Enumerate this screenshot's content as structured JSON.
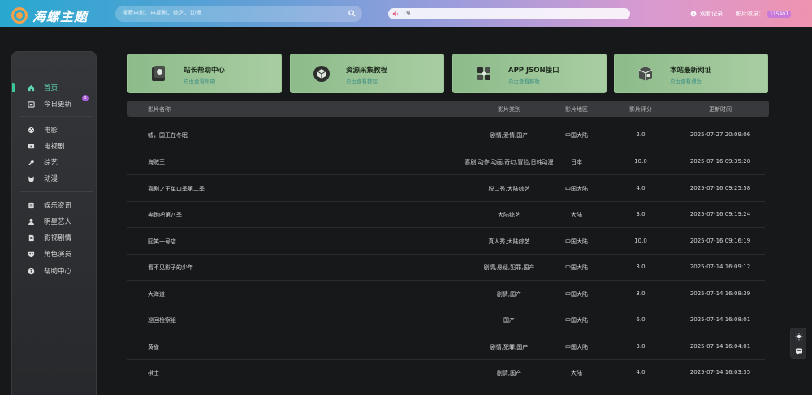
{
  "header": {
    "logo_text": "海螺主题",
    "search_placeholder": "搜索电影、电视剧、综艺、动漫",
    "notice_text": "19",
    "history_label": "观看记录",
    "stats_label": "影片收录：",
    "stats_count": "115407"
  },
  "sidebar": {
    "groups": [
      [
        {
          "label": "首页",
          "icon": "home-icon",
          "active": true
        },
        {
          "label": "今日更新",
          "icon": "calendar-icon",
          "badge": "0"
        }
      ],
      [
        {
          "label": "电影",
          "icon": "film-reel-icon"
        },
        {
          "label": "电视剧",
          "icon": "tv-icon"
        },
        {
          "label": "综艺",
          "icon": "microphone-icon"
        },
        {
          "label": "动漫",
          "icon": "cat-face-icon"
        }
      ],
      [
        {
          "label": "娱乐资讯",
          "icon": "news-icon"
        },
        {
          "label": "明星艺人",
          "icon": "user-icon"
        },
        {
          "label": "影视剧情",
          "icon": "script-icon"
        },
        {
          "label": "角色演员",
          "icon": "mask-icon"
        },
        {
          "label": "帮助中心",
          "icon": "question-icon"
        }
      ]
    ]
  },
  "cards": [
    {
      "title": "站长帮助中心",
      "subtitle": "点击查看帮助",
      "icon": "help-center-icon"
    },
    {
      "title": "资源采集教程",
      "subtitle": "点击查看教程",
      "icon": "resource-box-icon"
    },
    {
      "title": "APP JSON接口",
      "subtitle": "点击查看解析",
      "icon": "api-cube-icon"
    },
    {
      "title": "本站最新网址",
      "subtitle": "点击查看通告",
      "icon": "website-box-icon"
    }
  ],
  "table": {
    "headers": {
      "name": "影片名称",
      "type": "影片类别",
      "region": "影片地区",
      "score": "影片评分",
      "time": "更新时间"
    },
    "rows": [
      {
        "name": "嘘，国王在冬眠",
        "type": "剧情,爱情,国产",
        "region": "中国大陆",
        "score": "2.0",
        "time": "2025-07-27 20:09:06"
      },
      {
        "name": "海贼王",
        "type": "喜剧,动作,动画,奇幻,冒险,日韩动漫",
        "region": "日本",
        "score": "10.0",
        "time": "2025-07-16 09:35:28"
      },
      {
        "name": "喜剧之王单口季第二季",
        "type": "脱口秀,大陆综艺",
        "region": "中国大陆",
        "score": "4.0",
        "time": "2025-07-16 09:25:58"
      },
      {
        "name": "奔跑吧第八季",
        "type": "大陆综艺",
        "region": "大陆",
        "score": "3.0",
        "time": "2025-07-16 09:19:24"
      },
      {
        "name": "囧笑一号店",
        "type": "真人秀,大陆综艺",
        "region": "中国大陆",
        "score": "10.0",
        "time": "2025-07-16 09:16:19"
      },
      {
        "name": "看不见影子的少年",
        "type": "剧情,悬疑,犯罪,国产",
        "region": "中国大陆",
        "score": "3.0",
        "time": "2025-07-14 16:09:12"
      },
      {
        "name": "大海道",
        "type": "剧情,国产",
        "region": "中国大陆",
        "score": "3.0",
        "time": "2025-07-14 16:08:39"
      },
      {
        "name": "巡回检察组",
        "type": "国产",
        "region": "中国大陆",
        "score": "6.0",
        "time": "2025-07-14 16:08:01"
      },
      {
        "name": "黄雀",
        "type": "剧情,犯罪,国产",
        "region": "中国大陆",
        "score": "3.0",
        "time": "2025-07-14 16:04:01"
      },
      {
        "name": "棋士",
        "type": "剧情,国产",
        "region": "大陆",
        "score": "4.0",
        "time": "2025-07-14 16:03:35"
      }
    ]
  },
  "floating": {
    "items": [
      "theme-toggle-icon",
      "message-icon"
    ]
  },
  "colors": {
    "accent": "#3cc896",
    "card_bg": "#a9cda3",
    "card_link": "#3f8f86",
    "badge": "#a65bd8"
  }
}
